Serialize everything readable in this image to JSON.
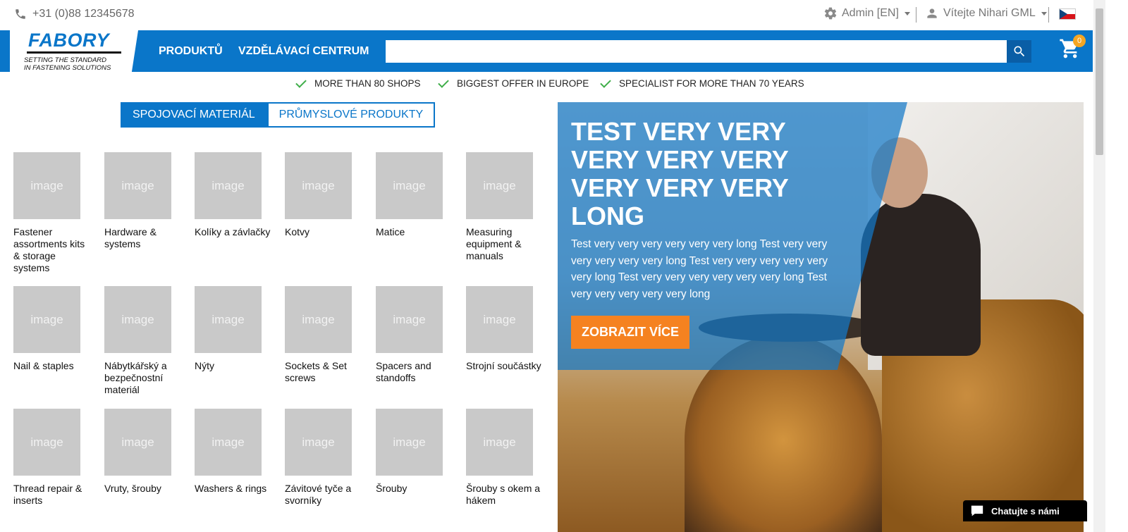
{
  "topbar": {
    "phone": "+31 (0)88 12345678",
    "admin_label": "Admin [EN]",
    "user_label": "Vítejte Nihari GML",
    "flag_icon": "czech-flag"
  },
  "header": {
    "logo_word": "FABORY",
    "logo_tagline_1": "SETTING THE STANDARD",
    "logo_tagline_2": "IN FASTENING SOLUTIONS",
    "nav": [
      "PRODUKTŮ",
      "VZDĚLÁVACÍ CENTRUM"
    ],
    "search_value": "",
    "search_placeholder": "",
    "cart_count": "0",
    "brand_color": "#0a76c9",
    "accent_color": "#f58220"
  },
  "usp": [
    "MORE THAN 80 SHOPS",
    "BIGGEST OFFER IN EUROPE",
    "SPECIALIST FOR MORE THAN 70 YEARS"
  ],
  "tabs": [
    "SPOJOVACÍ MATERIÁL",
    "PRŮMYSLOVÉ PRODUKTY"
  ],
  "categories": [
    {
      "image": "image",
      "label": "Fastener assortments kits & storage systems"
    },
    {
      "image": "image",
      "label": "Hardware & systems"
    },
    {
      "image": "image",
      "label": "Kolíky a závlačky"
    },
    {
      "image": "image",
      "label": "Kotvy"
    },
    {
      "image": "image",
      "label": "Matice"
    },
    {
      "image": "image",
      "label": "Measuring equipment & manuals"
    },
    {
      "image": "image",
      "label": "Nail & staples"
    },
    {
      "image": "image",
      "label": "Nábytkářský a bezpečnostní materiál"
    },
    {
      "image": "image",
      "label": "Nýty"
    },
    {
      "image": "image",
      "label": "Sockets & Set screws"
    },
    {
      "image": "image",
      "label": "Spacers and standoffs"
    },
    {
      "image": "image",
      "label": "Strojní součástky"
    },
    {
      "image": "image",
      "label": "Thread repair & inserts"
    },
    {
      "image": "image",
      "label": "Vruty, šrouby"
    },
    {
      "image": "image",
      "label": "Washers & rings"
    },
    {
      "image": "image",
      "label": "Závitové tyče a svorníky"
    },
    {
      "image": "image",
      "label": "Šrouby"
    },
    {
      "image": "image",
      "label": "Šrouby s okem a hákem"
    }
  ],
  "banner": {
    "title": "TEST VERY VERY VERY VERY VERY VERY VERY VERY LONG",
    "text": "Test very very very very very very long Test very very very very very very long Test very very very very very very long Test very very very very very very long Test very very very very very long",
    "button": "ZOBRAZIT VÍCE"
  },
  "chat": {
    "label": "Chatujte s námi"
  }
}
